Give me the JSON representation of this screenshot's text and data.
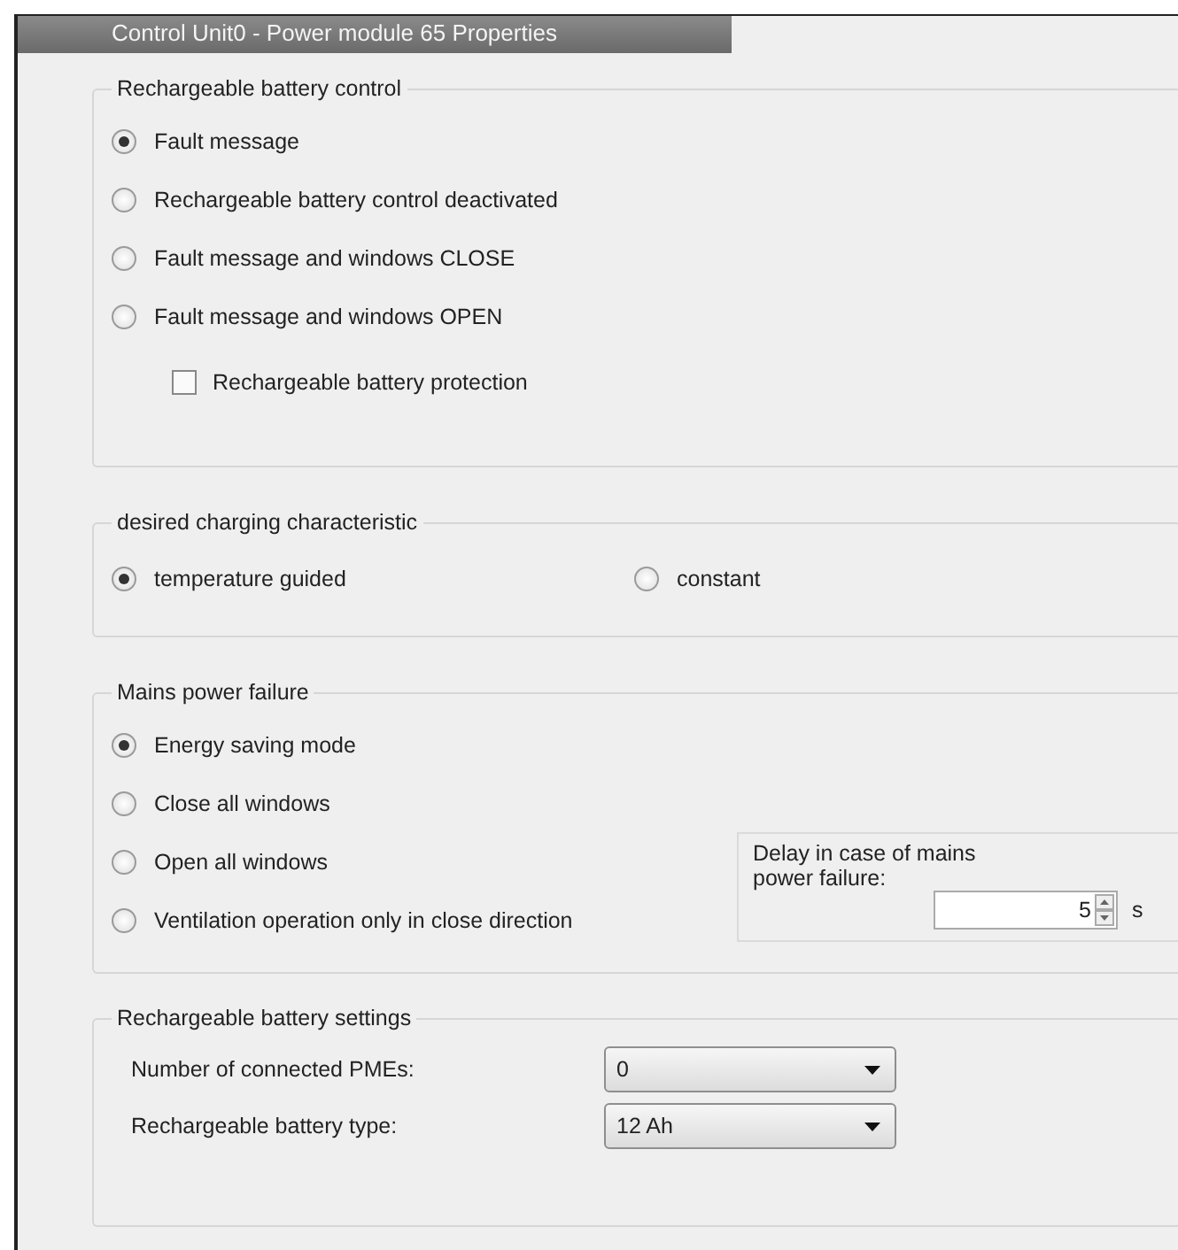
{
  "window": {
    "title": "Control Unit0 - Power module 65 Properties"
  },
  "battery_control": {
    "title": "Rechargeable battery control",
    "options": [
      {
        "label": "Fault message",
        "selected": true
      },
      {
        "label": "Rechargeable battery control deactivated",
        "selected": false
      },
      {
        "label": "Fault message and windows CLOSE",
        "selected": false
      },
      {
        "label": "Fault message and windows OPEN",
        "selected": false
      }
    ],
    "protection": {
      "label": "Rechargeable battery protection",
      "checked": false
    }
  },
  "charging": {
    "title": "desired charging characteristic",
    "options": [
      {
        "label": "temperature guided",
        "selected": true
      },
      {
        "label": "constant",
        "selected": false
      }
    ]
  },
  "mains_failure": {
    "title": "Mains power failure",
    "options": [
      {
        "label": "Energy saving mode",
        "selected": true
      },
      {
        "label": "Close all windows",
        "selected": false
      },
      {
        "label": "Open all windows",
        "selected": false
      },
      {
        "label": "Ventilation operation only in close direction",
        "selected": false
      }
    ],
    "delay": {
      "label": "Delay in case of mains power failure:",
      "value": "5",
      "unit": "s"
    }
  },
  "battery_settings": {
    "title": "Rechargeable battery settings",
    "fields": [
      {
        "label": "Number of connected PMEs:",
        "value": "0"
      },
      {
        "label": "Rechargeable battery type:",
        "value": "12 Ah"
      }
    ]
  }
}
